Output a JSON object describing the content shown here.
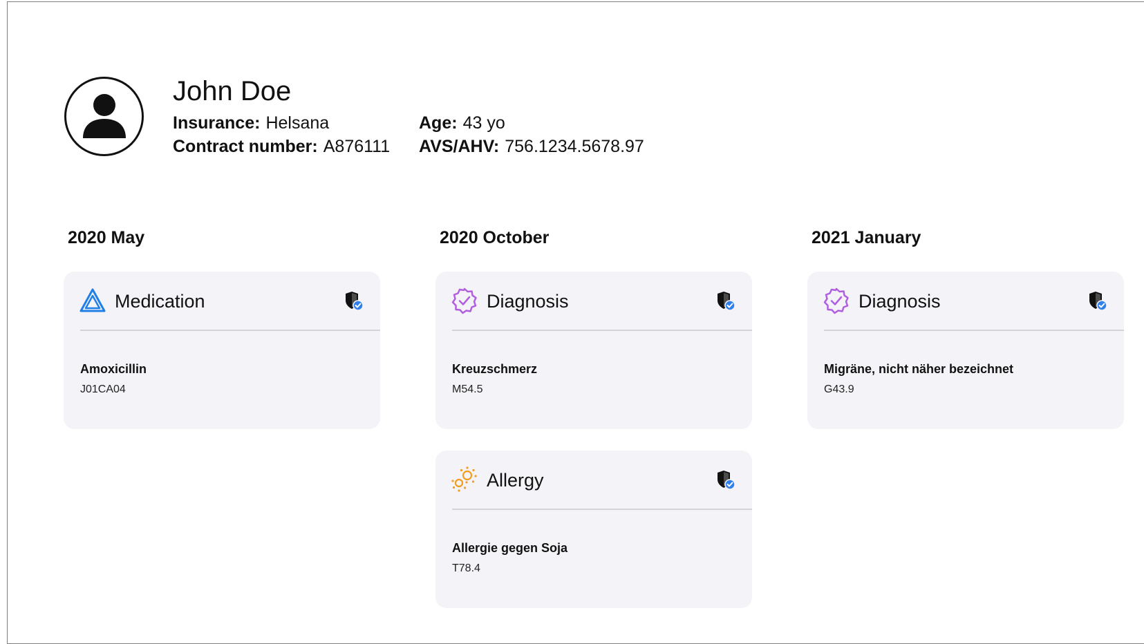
{
  "patient": {
    "name": "John Doe",
    "insurance_label": "Insurance:",
    "insurance": "Helsana",
    "contract_label": "Contract number:",
    "contract": "A876111",
    "age_label": "Age:",
    "age": "43 yo",
    "avs_label": "AVS/AHV:",
    "avs": "756.1234.5678.97"
  },
  "columns": [
    {
      "title": "2020 May",
      "cards": [
        {
          "type": "Medication",
          "icon": "medication-triangle-icon",
          "name": "Amoxicillin",
          "code": "J01CA04"
        }
      ]
    },
    {
      "title": "2020 October",
      "cards": [
        {
          "type": "Diagnosis",
          "icon": "diagnosis-badge-icon",
          "name": "Kreuzschmerz",
          "code": "M54.5"
        },
        {
          "type": "Allergy",
          "icon": "allergy-pollen-icon",
          "name": "Allergie gegen Soja",
          "code": "T78.4"
        }
      ]
    },
    {
      "title": "2021 January",
      "cards": [
        {
          "type": "Diagnosis",
          "icon": "diagnosis-badge-icon",
          "name": "Migräne, nicht näher bezeichnet",
          "code": "G43.9"
        }
      ]
    }
  ],
  "colors": {
    "medication": "#1f7fe6",
    "diagnosis": "#b15ee0",
    "allergy": "#f39c1e",
    "verified": "#2f80ed",
    "card_bg": "#f3f3f8"
  }
}
